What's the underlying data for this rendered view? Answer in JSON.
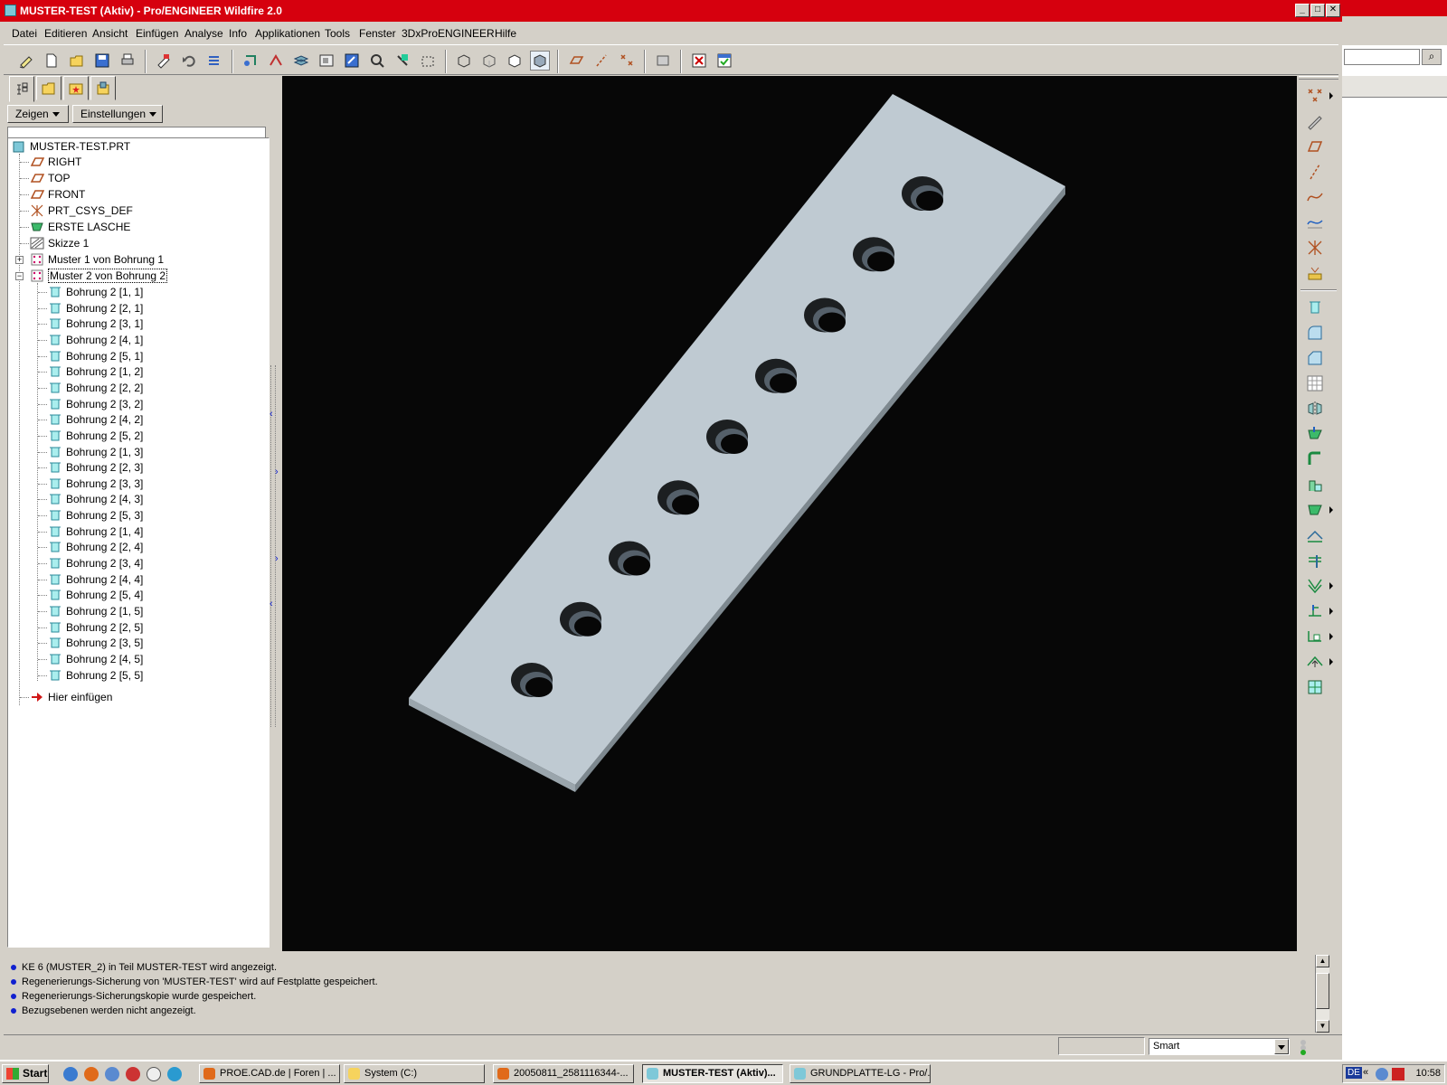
{
  "window": {
    "title": "MUSTER-TEST (Aktiv) - Pro/ENGINEER Wildfire 2.0"
  },
  "menu": [
    "Datei",
    "Editieren",
    "Ansicht",
    "Einfügen",
    "Analyse",
    "Info",
    "Applikationen",
    "Tools",
    "Fenster",
    "3DxProENGINEER",
    "Hilfe"
  ],
  "panel": {
    "show_label": "Zeigen",
    "settings_label": "Einstellungen"
  },
  "tree": {
    "root": "MUSTER-TEST.PRT",
    "features": [
      "RIGHT",
      "TOP",
      "FRONT",
      "PRT_CSYS_DEF",
      "ERSTE LASCHE",
      "Skizze 1",
      "Muster 1 von Bohrung 1",
      "Muster 2 von Bohrung 2"
    ],
    "pattern_members": [
      "Bohrung 2 [1, 1]",
      "Bohrung 2 [2, 1]",
      "Bohrung 2 [3, 1]",
      "Bohrung 2 [4, 1]",
      "Bohrung 2 [5, 1]",
      "Bohrung 2 [1, 2]",
      "Bohrung 2 [2, 2]",
      "Bohrung 2 [3, 2]",
      "Bohrung 2 [4, 2]",
      "Bohrung 2 [5, 2]",
      "Bohrung 2 [1, 3]",
      "Bohrung 2 [2, 3]",
      "Bohrung 2 [3, 3]",
      "Bohrung 2 [4, 3]",
      "Bohrung 2 [5, 3]",
      "Bohrung 2 [1, 4]",
      "Bohrung 2 [2, 4]",
      "Bohrung 2 [3, 4]",
      "Bohrung 2 [4, 4]",
      "Bohrung 2 [5, 4]",
      "Bohrung 2 [1, 5]",
      "Bohrung 2 [2, 5]",
      "Bohrung 2 [3, 5]",
      "Bohrung 2 [4, 5]",
      "Bohrung 2 [5, 5]"
    ],
    "insert_here": "Hier einfügen",
    "selected": "Muster 2 von Bohrung 2"
  },
  "messages": [
    "KE 6 (MUSTER_2) in Teil MUSTER-TEST wird angezeigt.",
    "Regenerierungs-Sicherung von 'MUSTER-TEST' wird auf Festplatte gespeichert.",
    "Regenerierungs-Sicherungskopie wurde gespeichert.",
    "Bezugsebenen werden nicht angezeigt."
  ],
  "status": {
    "filter": "Smart"
  },
  "taskbar": {
    "start": "Start",
    "items": [
      {
        "label": "PROE.CAD.de | Foren | ...",
        "active": false
      },
      {
        "label": "System (C:)",
        "active": false
      },
      {
        "label": "20050811_2581116344-...",
        "active": false
      },
      {
        "label": "MUSTER-TEST (Aktiv)...",
        "active": true
      },
      {
        "label": "GRUNDPLATTE-LG - Pro/...",
        "active": false
      }
    ],
    "tray_lang": "DE",
    "clock": "10:58"
  },
  "colors": {
    "titlebar": "#d6000e",
    "viewport_bg": "#070707",
    "part_top": "#bfcad2",
    "part_side": "#7d888f",
    "part_end": "#9aa5ac",
    "hole_shadow": "#1c1f21",
    "hole_wall": "#55606a"
  },
  "viewport": {
    "hole_count": 9
  }
}
